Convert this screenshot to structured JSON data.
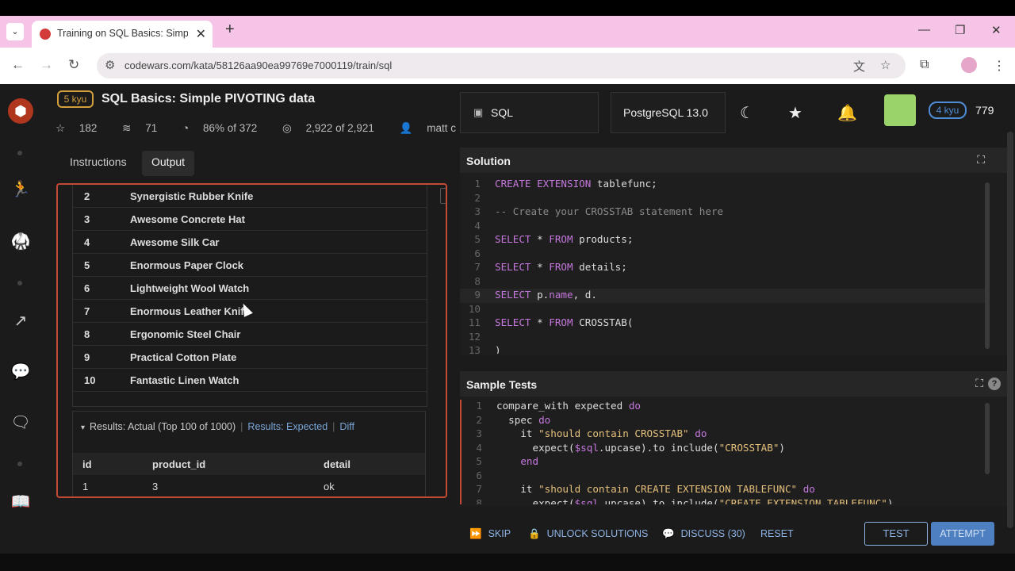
{
  "browser": {
    "tab_title": "Training on SQL Basics: Simple P",
    "url": "codewars.com/kata/58126aa90ea99769e7000119/train/sql",
    "icons": {
      "tab_list": "chevron-down-icon",
      "new_tab": "plus-icon",
      "minimize": "minimize-icon",
      "restore": "restore-icon",
      "close": "close-icon",
      "back": "arrow-left-icon",
      "forward": "arrow-right-icon",
      "reload": "reload-icon",
      "site_info": "tune-icon",
      "translate": "translate-icon",
      "bookmark": "star-icon",
      "extensions": "puzzle-icon",
      "menu": "kebab-icon"
    },
    "glyphs": {
      "tab_list": "⌄",
      "close_tab": "✕",
      "new_tab": "+",
      "minimize": "—",
      "restore": "❐",
      "close": "✕",
      "back": "←",
      "forward": "→",
      "reload": "↻",
      "site_info": "⚙",
      "translate": "文",
      "bookmark": "☆",
      "extensions": "⧉",
      "menu": "⋮"
    }
  },
  "kata": {
    "rank": "5 kyu",
    "title": "SQL Basics: Simple PIVOTING data",
    "stats": {
      "stars": "182",
      "collections": "71",
      "satisfaction": "86% of 372",
      "completions": "2,922 of 2,921",
      "author": "matt c"
    },
    "glyphs": {
      "stars": "☆",
      "collections": "≋",
      "satisfaction": "◔",
      "completions": "◎",
      "author": "👤"
    }
  },
  "left_nav": {
    "logo_glyph": "⬢",
    "glyphs": {
      "practice": "🏃",
      "kumite": "🥋",
      "leaderboards": "↗",
      "chat": "💬",
      "discussions": "🗨",
      "docs": "📖"
    }
  },
  "instructions_tabs": [
    "Instructions",
    "Output"
  ],
  "output": {
    "rows": [
      {
        "id": "2",
        "name": "Synergistic Rubber Knife"
      },
      {
        "id": "3",
        "name": "Awesome Concrete Hat"
      },
      {
        "id": "4",
        "name": "Awesome Silk Car"
      },
      {
        "id": "5",
        "name": "Enormous Paper Clock"
      },
      {
        "id": "6",
        "name": "Lightweight Wool Watch"
      },
      {
        "id": "7",
        "name": "Enormous Leather Knife"
      },
      {
        "id": "8",
        "name": "Ergonomic Steel Chair"
      },
      {
        "id": "9",
        "name": "Practical Cotton Plate"
      },
      {
        "id": "10",
        "name": "Fantastic Linen Watch"
      }
    ],
    "results_actual": "Results: Actual (Top 100 of 1000)",
    "results_expected": "Results: Expected",
    "diff": "Diff",
    "columns": [
      "id",
      "product_id",
      "detail"
    ],
    "first_row": [
      "1",
      "3",
      "ok"
    ],
    "caret_glyph": "▾",
    "separator": "|"
  },
  "toolbar": {
    "language": "SQL",
    "language_glyph": "▣",
    "version": "PostgreSQL 13.0",
    "glyphs": {
      "theme": "☾",
      "bookmark": "★",
      "notifications": "🔔"
    },
    "user_rank": "4 kyu",
    "honor": "779"
  },
  "solution": {
    "title": "Solution",
    "expand_glyph": "⛶",
    "lines": [
      {
        "n": "1",
        "text": "CREATE EXTENSION tablefunc;"
      },
      {
        "n": "2",
        "text": ""
      },
      {
        "n": "3",
        "text": "-- Create your CROSSTAB statement here"
      },
      {
        "n": "4",
        "text": ""
      },
      {
        "n": "5",
        "text": "SELECT * FROM products;"
      },
      {
        "n": "6",
        "text": ""
      },
      {
        "n": "7",
        "text": "SELECT * FROM details;"
      },
      {
        "n": "8",
        "text": ""
      },
      {
        "n": "9",
        "text": "SELECT p.name, d."
      },
      {
        "n": "10",
        "text": ""
      },
      {
        "n": "11",
        "text": "SELECT * FROM CROSSTAB("
      },
      {
        "n": "12",
        "text": ""
      },
      {
        "n": "13",
        "text": ")"
      }
    ]
  },
  "tests": {
    "title": "Sample Tests",
    "expand_glyph": "⛶",
    "help_glyph": "?",
    "lines": [
      {
        "n": "1",
        "text": "compare_with expected do"
      },
      {
        "n": "2",
        "text": "  spec do"
      },
      {
        "n": "3",
        "text": "    it \"should contain CROSSTAB\" do"
      },
      {
        "n": "4",
        "text": "      expect($sql.upcase).to include(\"CROSSTAB\")"
      },
      {
        "n": "5",
        "text": "    end"
      },
      {
        "n": "6",
        "text": ""
      },
      {
        "n": "7",
        "text": "    it \"should contain CREATE EXTENSION TABLEFUNC\" do"
      },
      {
        "n": "8",
        "text": "      expect($sql.upcase).to include(\"CREATE EXTENSION TABLEFUNC\")"
      }
    ]
  },
  "actions": {
    "skip": "SKIP",
    "unlock": "UNLOCK SOLUTIONS",
    "discuss": "DISCUSS (30)",
    "reset": "RESET",
    "test": "TEST",
    "attempt": "ATTEMPT",
    "glyphs": {
      "skip": "⏩",
      "unlock": "🔒",
      "discuss": "💬"
    }
  },
  "colors": {
    "accent_red": "#c14a35",
    "rank_yellow": "#d39f3d",
    "rank_blue": "#4f8dd6",
    "link_blue": "#8eb4e6",
    "tabstrip_pink": "#f5c4e6"
  }
}
